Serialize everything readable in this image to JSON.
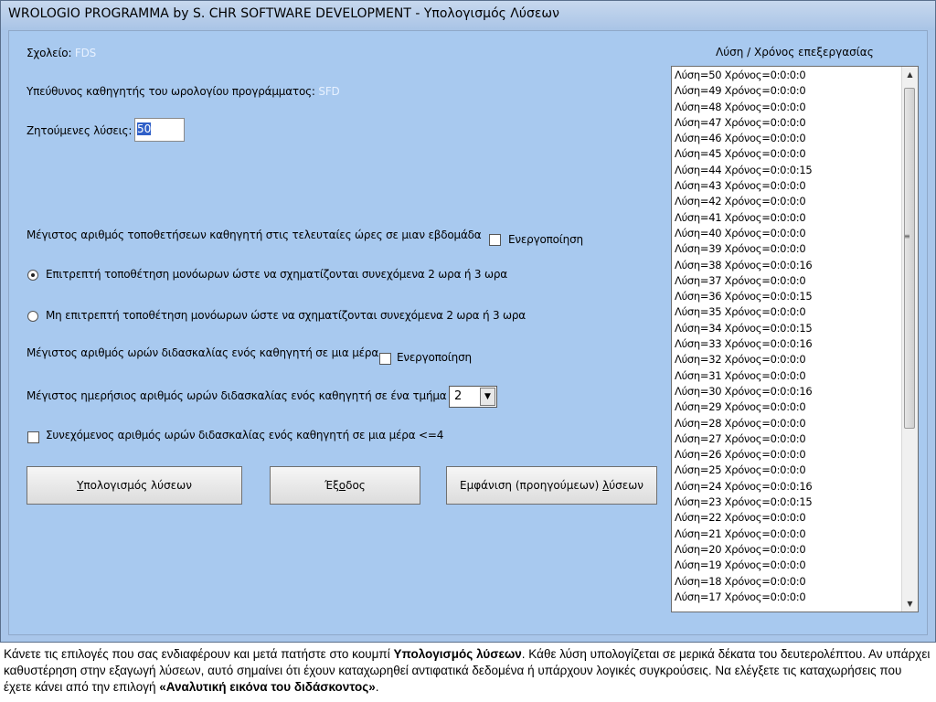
{
  "window": {
    "title": "WROLOGIO PROGRAMMA by S. CHR SOFTWARE DEVELOPMENT - Υπολογισμός Λύσεων"
  },
  "form": {
    "school_label": "Σχολείο:",
    "school_value": "FDS",
    "teacher_label": "Υπεύθυνος καθηγητής του ωρολογίου προγράμματος:",
    "teacher_value": "SFD",
    "solutions_label": "Ζητούμενες λύσεις:",
    "solutions_value": "50",
    "max_last_hours_label": "Μέγιστος αριθμός τοποθετήσεων καθηγητή στις τελευταίες ώρες σε μιαν εβδομάδα",
    "max_last_hours_check_label": "Ενεργοποίηση",
    "max_last_hours_checked": false,
    "radio_allow_label": "Επιτρεπτή τοποθέτηση μονόωρων ώστε να σχηματίζονται συνεχόμενα 2 ωρα ή 3 ωρα",
    "radio_deny_label": "Μη επιτρεπτή τοποθέτηση μονόωρων ώστε να σχηματίζονται συνεχόμενα 2 ωρα ή 3 ωρα",
    "radio_selected": "allow",
    "max_daily_hours_label": "Μέγιστος αριθμός ωρών διδασκαλίας ενός καθηγητή σε μια μέρα",
    "max_daily_hours_check_label": "Ενεργοποίηση",
    "max_daily_hours_checked": false,
    "max_daily_section_label": "Μέγιστος ημερήσιος αριθμός ωρών διδασκαλίας ενός καθηγητή σε ένα τμήμα",
    "max_daily_section_value": "2",
    "consecutive_label": "Συνεχόμενος αριθμός ωρών διδασκαλίας ενός καθηγητή σε μια μέρα <=4",
    "consecutive_checked": false
  },
  "buttons": {
    "compute_prefix": "",
    "compute_mnemonic": "Υ",
    "compute_rest": "πολογισμός λύσεων",
    "exit_prefix": "Έξ",
    "exit_mnemonic": "ο",
    "exit_rest": "δος",
    "show_prefix": "Εμφάνιση (προηγούμεων) ",
    "show_mnemonic": "λ",
    "show_rest": "ύσεων"
  },
  "solutions_list": {
    "header": "Λύση / Χρόνος επεξεργασίας",
    "items": [
      "Λύση=50 Χρόνος=0:0:0:0",
      "Λύση=49 Χρόνος=0:0:0:0",
      "Λύση=48 Χρόνος=0:0:0:0",
      "Λύση=47 Χρόνος=0:0:0:0",
      "Λύση=46 Χρόνος=0:0:0:0",
      "Λύση=45 Χρόνος=0:0:0:0",
      "Λύση=44 Χρόνος=0:0:0:15",
      "Λύση=43 Χρόνος=0:0:0:0",
      "Λύση=42 Χρόνος=0:0:0:0",
      "Λύση=41 Χρόνος=0:0:0:0",
      "Λύση=40 Χρόνος=0:0:0:0",
      "Λύση=39 Χρόνος=0:0:0:0",
      "Λύση=38 Χρόνος=0:0:0:16",
      "Λύση=37 Χρόνος=0:0:0:0",
      "Λύση=36 Χρόνος=0:0:0:15",
      "Λύση=35 Χρόνος=0:0:0:0",
      "Λύση=34 Χρόνος=0:0:0:15",
      "Λύση=33 Χρόνος=0:0:0:16",
      "Λύση=32 Χρόνος=0:0:0:0",
      "Λύση=31 Χρόνος=0:0:0:0",
      "Λύση=30 Χρόνος=0:0:0:16",
      "Λύση=29 Χρόνος=0:0:0:0",
      "Λύση=28 Χρόνος=0:0:0:0",
      "Λύση=27 Χρόνος=0:0:0:0",
      "Λύση=26 Χρόνος=0:0:0:0",
      "Λύση=25 Χρόνος=0:0:0:0",
      "Λύση=24 Χρόνος=0:0:0:16",
      "Λύση=23 Χρόνος=0:0:0:15",
      "Λύση=22 Χρόνος=0:0:0:0",
      "Λύση=21 Χρόνος=0:0:0:0",
      "Λύση=20 Χρόνος=0:0:0:0",
      "Λύση=19 Χρόνος=0:0:0:0",
      "Λύση=18 Χρόνος=0:0:0:0",
      "Λύση=17 Χρόνος=0:0:0:0"
    ]
  },
  "caption": {
    "part1": "Κάνετε τις επιλογές που σας ενδιαφέρουν και μετά πατήστε στο κουμπί ",
    "bold1": "Υπολογισμός λύσεων",
    "part2": ". Κάθε λύση υπολογίζεται σε μερικά δέκατα του δευτερολέπτου. Αν υπάρχει καθυστέρηση στην εξαγωγή λύσεων, αυτό σημαίνει ότι έχουν καταχωρηθεί αντιφατικά δεδομένα ή υπάρχουν λογικές συγκρούσεις.  Να ελέγξετε τις καταχωρήσεις που έχετε κάνει από την επιλογή ",
    "bold2": "«Αναλυτική εικόνα του διδάσκοντος»",
    "part3": "."
  }
}
